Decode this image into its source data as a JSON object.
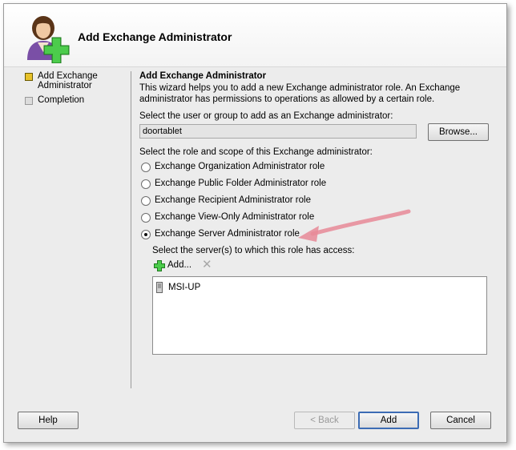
{
  "window": {
    "title": "Add Exchange Administrator"
  },
  "steps": [
    {
      "label": "Add Exchange Administrator",
      "state": "active"
    },
    {
      "label": "Completion",
      "state": "pending"
    }
  ],
  "content": {
    "section_title": "Add Exchange Administrator",
    "description": "This wizard helps you to add a new Exchange administrator role.  An Exchange administrator has permissions to operations as allowed by a certain role.",
    "user_label": "Select the user or group to add as an Exchange administrator:",
    "user_value": "doortablet",
    "browse_label": "Browse...",
    "role_label": "Select the role and scope of this Exchange administrator:",
    "roles": [
      {
        "label": "Exchange Organization Administrator role",
        "checked": false
      },
      {
        "label": "Exchange Public Folder Administrator role",
        "checked": false
      },
      {
        "label": "Exchange Recipient Administrator role",
        "checked": false
      },
      {
        "label": "Exchange View-Only Administrator role",
        "checked": false
      },
      {
        "label": "Exchange Server Administrator role",
        "checked": true
      }
    ],
    "servers_label": "Select the server(s) to which this role has access:",
    "add_label": "Add...",
    "servers": [
      "MSI-UP"
    ]
  },
  "footer": {
    "help_label": "Help",
    "back_label": "< Back",
    "add_label": "Add",
    "cancel_label": "Cancel"
  },
  "colors": {
    "accent_border": "#3c6cb4",
    "annotation_arrow": "#e88a98",
    "active_step": "#e8c22a",
    "plus_green": "#3cb43c"
  },
  "icons": [
    "admin-avatar-icon",
    "plus-icon",
    "delete-x-icon",
    "server-icon",
    "radio-icon"
  ]
}
